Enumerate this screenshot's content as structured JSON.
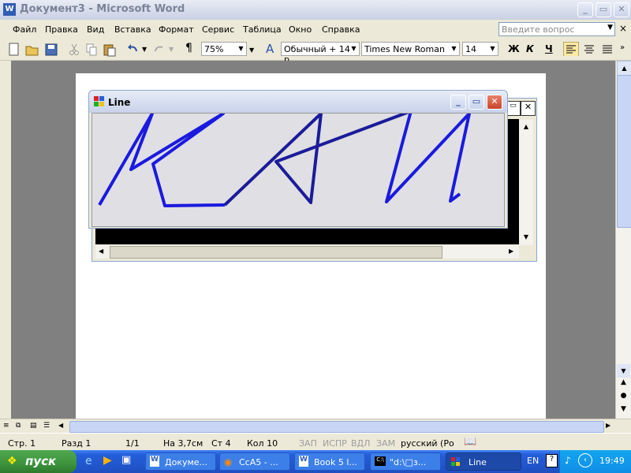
{
  "word_window": {
    "title": "Документ3 - Microsoft Word",
    "minimize": "_",
    "maximize": "▭",
    "close": "✕"
  },
  "menu": {
    "items": [
      "Файл",
      "Правка",
      "Вид",
      "Вставка",
      "Формат",
      "Сервис",
      "Таблица",
      "Окно",
      "Справка"
    ],
    "help_placeholder": "Введите вопрос"
  },
  "toolbar": {
    "zoom": "75%",
    "style": "Обычный + 14 р",
    "font": "Times New Roman",
    "size": "14",
    "bold": "Ж",
    "italic": "К",
    "underline": "Ч"
  },
  "line_window": {
    "title": "Line"
  },
  "status": {
    "page": "Стр. 1",
    "section": "Разд 1",
    "pages": "1/1",
    "position": "На 3,7см",
    "line": "Ст 4",
    "column": "Кол 10",
    "rec": "ЗАП",
    "trk": "ИСПР",
    "ext": "ВДЛ",
    "ovr": "ЗАМ",
    "language": "русский (Ро"
  },
  "taskbar": {
    "start": "пуск",
    "tasks": [
      "Докуме...",
      "CcA5 - ...",
      "Book 5 l...",
      "\"d:\\□з...",
      "Line"
    ],
    "lang": "EN",
    "clock": "19:49"
  },
  "colors": {
    "stroke": "#1a1adf",
    "stroke_dark": "#1b1b9a",
    "taskbar": "#245edb",
    "start": "#3d933d"
  }
}
